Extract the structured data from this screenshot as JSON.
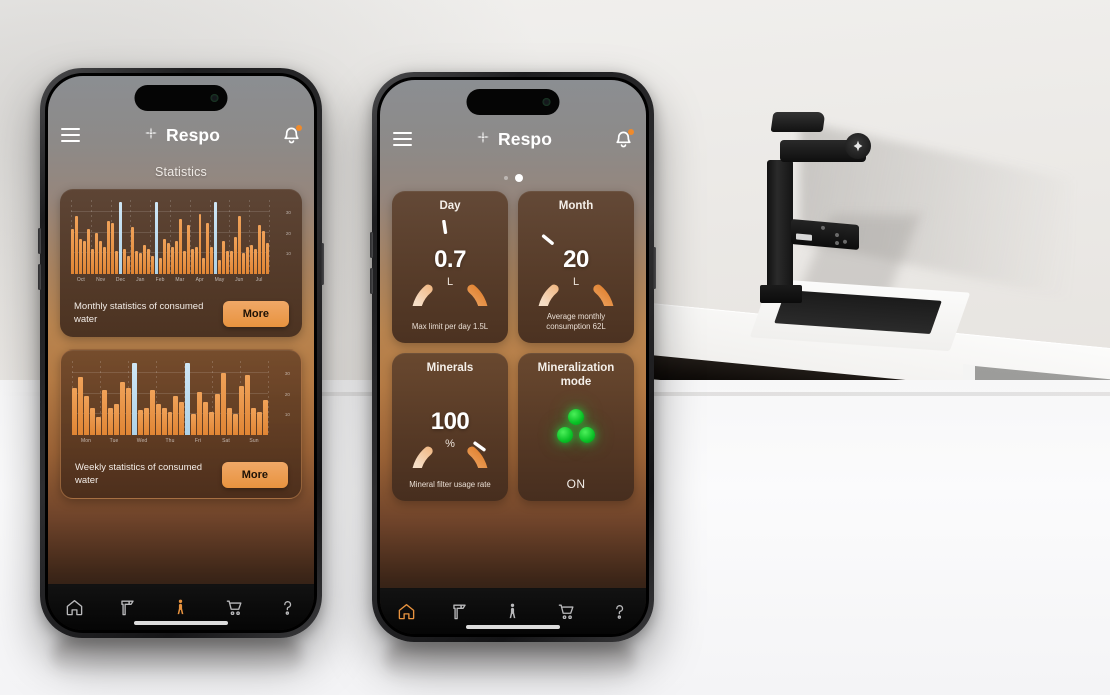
{
  "scene": {
    "description": "Kitchen countertop with black faucet, two smartphones in front",
    "colors": {
      "accent_orange": "#e8933f",
      "bar_orange": "#e78a3a",
      "bar_highlight": "#bcdcef",
      "led_green": "#16cf2e",
      "screen_top": "#8b8e92",
      "screen_bottom": "#1a1210"
    }
  },
  "phone1": {
    "header": {
      "menu_icon": "hamburger-icon",
      "brand_icon": "respo-logo-icon",
      "brand_name": "Respo",
      "notification_icon": "bell-icon",
      "notification_badge": true
    },
    "page_title": "Statistics",
    "cards": [
      {
        "caption": "Monthly statistics of consumed water",
        "button_label": "More",
        "chart": {
          "ref": "monthly"
        }
      },
      {
        "caption": "Weekly statistics of consumed water",
        "button_label": "More",
        "chart": {
          "ref": "weekly"
        }
      }
    ],
    "nav": {
      "items": [
        {
          "icon": "home-icon",
          "name": "nav-home",
          "active": false
        },
        {
          "icon": "faucet-icon",
          "name": "nav-faucet",
          "active": false
        },
        {
          "icon": "person-icon",
          "name": "nav-profile",
          "active": true
        },
        {
          "icon": "cart-icon",
          "name": "nav-cart",
          "active": false
        },
        {
          "icon": "help-icon",
          "name": "nav-help",
          "active": false
        }
      ]
    }
  },
  "phone2": {
    "header": {
      "menu_icon": "hamburger-icon",
      "brand_icon": "respo-logo-icon",
      "brand_name": "Respo",
      "notification_icon": "bell-icon",
      "notification_badge": true
    },
    "pager": {
      "count": 2,
      "active_index": 1
    },
    "tiles": [
      {
        "title": "Day",
        "value": "0.7",
        "unit": "L",
        "footer": "Max limit per day 1.5L",
        "gauge_percent": 47,
        "type": "gauge"
      },
      {
        "title": "Month",
        "value": "20",
        "unit": "L",
        "footer": "Average monthly consumption 62L",
        "gauge_percent": 32,
        "type": "gauge"
      },
      {
        "title": "Minerals",
        "value": "100",
        "unit": "%",
        "footer": "Mineral filter usage rate",
        "gauge_percent": 95,
        "type": "gauge"
      },
      {
        "title": "Mineralization mode",
        "state": "ON",
        "type": "indicator",
        "led_count": 3
      }
    ],
    "nav": {
      "items": [
        {
          "icon": "home-icon",
          "name": "nav-home",
          "active": true
        },
        {
          "icon": "faucet-icon",
          "name": "nav-faucet",
          "active": false
        },
        {
          "icon": "person-icon",
          "name": "nav-profile",
          "active": false
        },
        {
          "icon": "cart-icon",
          "name": "nav-cart",
          "active": false
        },
        {
          "icon": "help-icon",
          "name": "nav-help",
          "active": false
        }
      ]
    }
  },
  "chart_data": [
    {
      "id": "monthly",
      "type": "bar",
      "title": "Monthly statistics of consumed water",
      "xlabel": "",
      "ylabel": "",
      "ylim": [
        0,
        36
      ],
      "grid": true,
      "yticks": [
        10,
        20,
        30
      ],
      "categories": [
        "Oct",
        "Nov",
        "Dec",
        "Jan",
        "Feb",
        "Mar",
        "Apr",
        "May",
        "Jun",
        "Jul"
      ],
      "values": [
        22,
        28,
        17,
        16,
        22,
        12,
        20,
        16,
        13,
        26,
        25,
        11,
        35,
        12,
        9,
        23,
        11,
        10,
        14,
        12,
        9,
        35,
        8,
        17,
        15,
        13,
        16,
        27,
        11,
        24,
        12,
        13,
        29,
        8,
        25,
        13,
        35,
        7,
        16,
        11,
        11,
        18,
        28,
        10,
        13,
        14,
        12,
        24,
        21,
        15
      ],
      "highlight_indices": [
        12,
        21,
        36
      ],
      "highlight_color": "#bcdcef",
      "bar_color": "#e78a3a"
    },
    {
      "id": "weekly",
      "type": "bar",
      "title": "Weekly statistics of consumed water",
      "xlabel": "",
      "ylabel": "",
      "ylim": [
        0,
        36
      ],
      "grid": true,
      "yticks": [
        10,
        20,
        30
      ],
      "categories": [
        "Mon",
        "Tue",
        "Wed",
        "Thu",
        "Fri",
        "Sat",
        "Sun"
      ],
      "values": [
        23,
        28,
        19,
        13,
        9,
        22,
        13,
        15,
        26,
        23,
        35,
        12,
        13,
        22,
        15,
        13,
        11,
        19,
        16,
        34,
        10,
        21,
        16,
        11,
        20,
        30,
        13,
        10,
        24,
        29,
        13,
        11,
        17
      ],
      "highlight_indices": [
        10,
        19
      ],
      "highlight_color": "#bcdcef",
      "bar_color": "#e78a3a"
    }
  ]
}
